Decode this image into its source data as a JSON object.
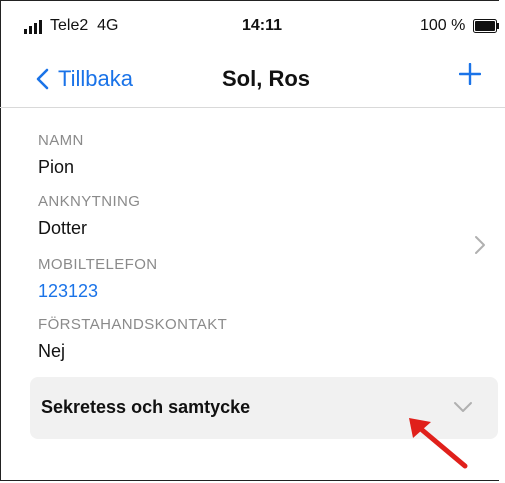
{
  "status_bar": {
    "carrier": "Tele2",
    "network": "4G",
    "time": "14:11",
    "battery": "100 %"
  },
  "nav": {
    "back_label": "Tillbaka",
    "title": "Sol, Ros"
  },
  "contact": {
    "name_label": "NAMN",
    "name_value": "Pion",
    "relation_label": "ANKNYTNING",
    "relation_value": "Dotter",
    "mobile_label": "MOBILTELEFON",
    "mobile_value": "123123",
    "primary_label": "FÖRSTAHANDSKONTAKT",
    "primary_value": "Nej"
  },
  "section": {
    "title": "Sekretess och samtycke"
  },
  "colors": {
    "accent": "#1a73e8",
    "annotation_arrow": "#e0201b"
  },
  "icons": [
    "signal-icon",
    "battery-icon",
    "chevron-left-icon",
    "plus-icon",
    "chevron-right-icon",
    "chevron-down-icon",
    "annotation-arrow"
  ]
}
